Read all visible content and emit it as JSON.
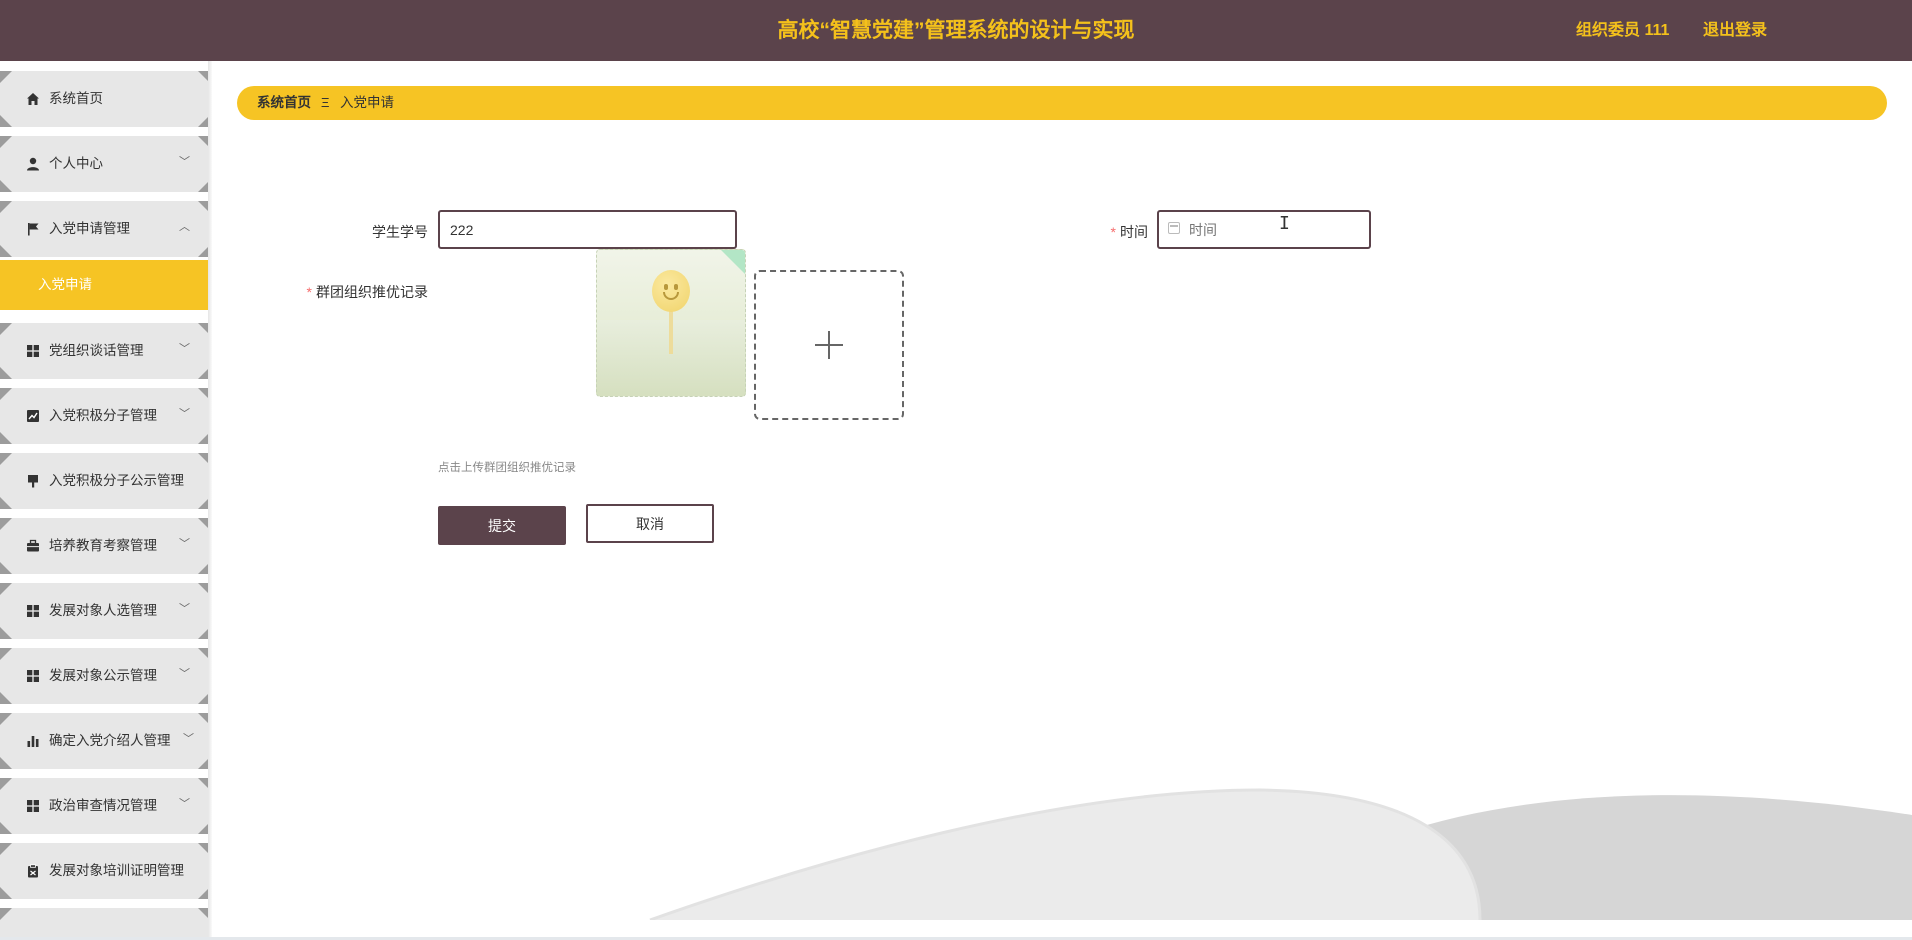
{
  "header": {
    "title": "高校“智慧党建”管理系统的设计与实现",
    "user": "组织委员 111",
    "logout": "退出登录"
  },
  "sidebar": {
    "items": [
      {
        "label": "系统首页",
        "icon": "home-icon",
        "arrow": ""
      },
      {
        "label": "个人中心",
        "icon": "user-icon",
        "arrow": "﹀"
      },
      {
        "label": "入党申请管理",
        "icon": "flag-icon",
        "arrow": "︿"
      },
      {
        "label": "党组织谈话管理",
        "icon": "grid-icon",
        "arrow": "﹀"
      },
      {
        "label": "入党积极分子管理",
        "icon": "chart-line-icon",
        "arrow": "﹀"
      },
      {
        "label": "入党积极分子公示管理",
        "icon": "brush-icon",
        "arrow": ""
      },
      {
        "label": "培养教育考察管理",
        "icon": "briefcase-icon",
        "arrow": "﹀"
      },
      {
        "label": "发展对象人选管理",
        "icon": "grid-icon",
        "arrow": "﹀"
      },
      {
        "label": "发展对象公示管理",
        "icon": "grid-icon",
        "arrow": "﹀"
      },
      {
        "label": "确定入党介绍人管理",
        "icon": "bar-chart-icon",
        "arrow": "﹀"
      },
      {
        "label": "政治审查情况管理",
        "icon": "grid-icon",
        "arrow": "﹀"
      },
      {
        "label": "发展对象培训证明管理",
        "icon": "clipboard-icon",
        "arrow": ""
      }
    ],
    "active_sub": "入党申请"
  },
  "breadcrumb": {
    "home": "系统首页",
    "separator": "Ξ",
    "current": "入党申请"
  },
  "form": {
    "student_id_label": "学生学号",
    "student_id_value": "222",
    "time_label": "时间",
    "time_placeholder": "时间",
    "required_mark": "*",
    "record_label": "群团组织推优记录",
    "upload_tip": "点击上传群团组织推优记录",
    "submit": "提交",
    "cancel": "取消"
  }
}
